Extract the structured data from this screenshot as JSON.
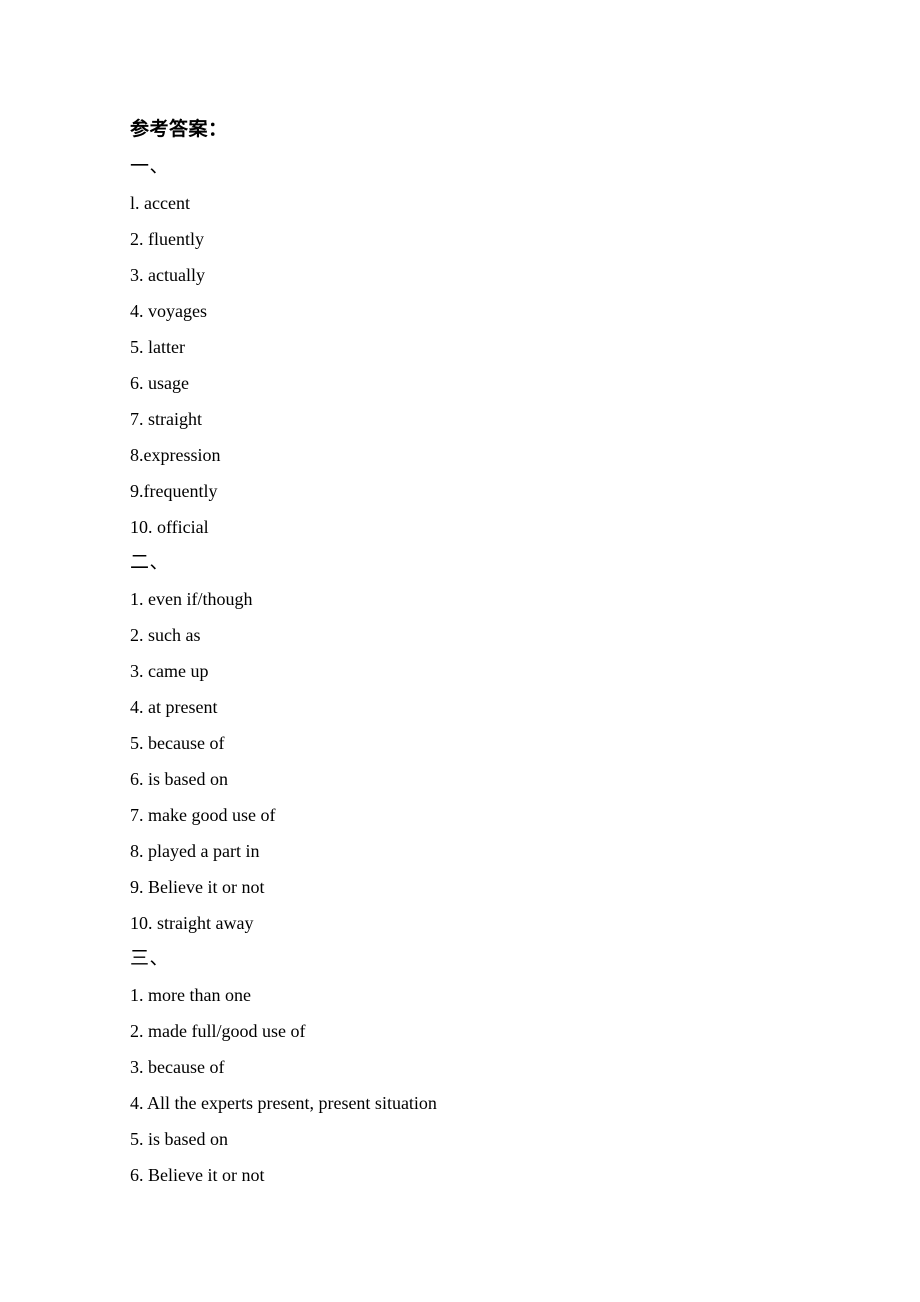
{
  "document": {
    "title": "参考答案：",
    "sections": [
      {
        "marker": "一、",
        "items": [
          "l. accent",
          "2. fluently",
          "3. actually",
          "4. voyages",
          "5. latter",
          "6. usage",
          "7. straight",
          "8.expression",
          "9.frequently",
          "10. official"
        ]
      },
      {
        "marker": "二、",
        "items": [
          "1. even if/though",
          "2. such as",
          "3. came up",
          "4. at present",
          "5. because of",
          "6. is based on",
          "7. make good use of",
          "8. played a part in",
          "9. Believe it or not",
          "10. straight away"
        ]
      },
      {
        "marker": "三、",
        "items": [
          "1. more than one",
          "2. made full/good use of",
          "3. because of",
          "4. All the experts present, present situation",
          "5. is based on",
          "6. Believe it or not"
        ]
      }
    ]
  }
}
